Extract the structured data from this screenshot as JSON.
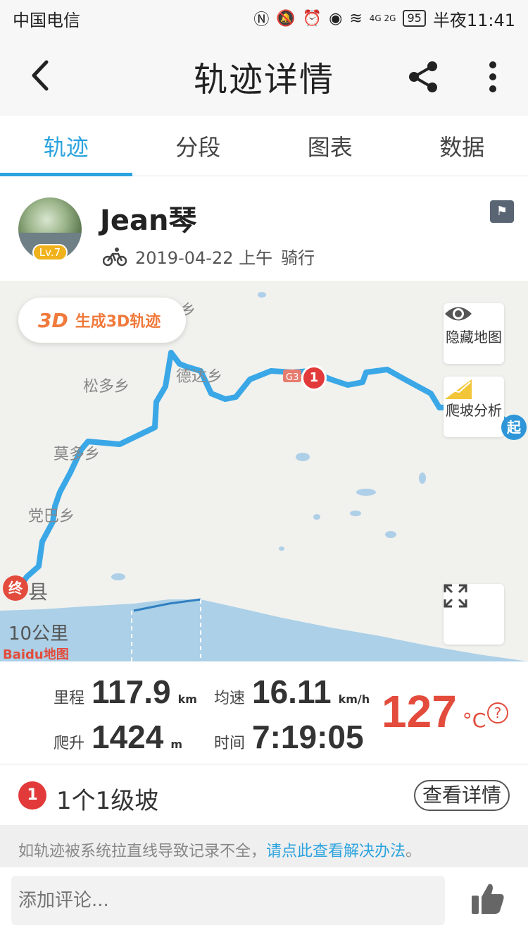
{
  "status": {
    "carrier": "中国电信",
    "battery": "95",
    "time": "半夜11:41",
    "network": "4G 2G"
  },
  "header": {
    "title": "轨迹详情"
  },
  "tabs": [
    {
      "label": "轨迹",
      "active": true
    },
    {
      "label": "分段",
      "active": false
    },
    {
      "label": "图表",
      "active": false
    },
    {
      "label": "数据",
      "active": false
    }
  ],
  "profile": {
    "username": "Jean琴",
    "level": "Lv.7",
    "date": "2019-04-22 上午",
    "activity": "骑行"
  },
  "map": {
    "btn_3d_badge": "3D",
    "btn_3d_label": "生成3D轨迹",
    "hide_map_label": "隐藏地图",
    "climb_analysis_label": "爬坡分析",
    "start_label": "起",
    "end_label": "终",
    "climb_marker": "1",
    "scale_label": "10公里",
    "map_logo": "Baidu地图",
    "places": [
      "松多乡",
      "德达乡",
      "莫多乡",
      "党巴乡",
      "县",
      "乡"
    ],
    "route_color": "#3aa7e6"
  },
  "stats": {
    "distance_label": "里程",
    "distance_value": "117.9",
    "distance_unit": "km",
    "speed_label": "均速",
    "speed_value": "16.11",
    "speed_unit": "km/h",
    "climb_label": "爬升",
    "climb_value": "1424",
    "climb_unit": "m",
    "time_label": "时间",
    "time_value": "7:19:05",
    "temp_value": "127",
    "temp_unit": "°C",
    "help_label": "?"
  },
  "climbs": {
    "icon": "1",
    "summary": "1个1级坡",
    "detail_button": "查看详情"
  },
  "notice": {
    "text": "如轨迹被系统拉直线导致记录不全，",
    "link": "请点此查看解决办法",
    "end": "。"
  },
  "comment": {
    "placeholder": "添加评论..."
  }
}
